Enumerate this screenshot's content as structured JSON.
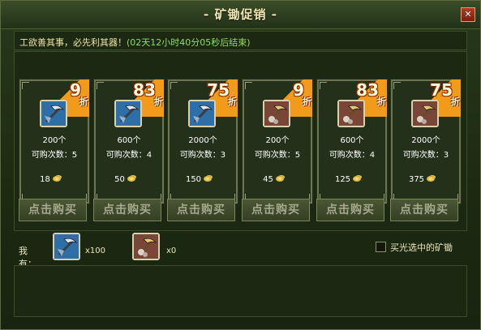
{
  "window": {
    "title": "- 矿锄促销 -",
    "close_label": "✕"
  },
  "promo": {
    "text": "工欲善其事，必先利其器！",
    "timer": "(02天12小时40分05秒后结束)"
  },
  "cards": [
    {
      "discount": "9",
      "discount_suffix": "折",
      "quantity": "200个",
      "limit": "可购次数：5",
      "price": "18",
      "buy_label": "点击购买",
      "icon": "steel-pickaxe-icon"
    },
    {
      "discount": "83",
      "discount_suffix": "折",
      "quantity": "600个",
      "limit": "可购次数：4",
      "price": "50",
      "buy_label": "点击购买",
      "icon": "steel-pickaxe-icon"
    },
    {
      "discount": "75",
      "discount_suffix": "折",
      "quantity": "2000个",
      "limit": "可购次数：3",
      "price": "150",
      "buy_label": "点击购买",
      "icon": "steel-pickaxe-icon"
    },
    {
      "discount": "9",
      "discount_suffix": "折",
      "quantity": "200个",
      "limit": "可购次数：5",
      "price": "45",
      "buy_label": "点击购买",
      "icon": "gold-pickaxe-icon"
    },
    {
      "discount": "83",
      "discount_suffix": "折",
      "quantity": "600个",
      "limit": "可购次数：4",
      "price": "125",
      "buy_label": "点击购买",
      "icon": "gold-pickaxe-icon"
    },
    {
      "discount": "75",
      "discount_suffix": "折",
      "quantity": "2000个",
      "limit": "可购次数：3",
      "price": "375",
      "buy_label": "点击购买",
      "icon": "gold-pickaxe-icon"
    }
  ],
  "owned": {
    "label": "我有：",
    "items": [
      {
        "icon": "steel-pickaxe-icon",
        "count": "x100"
      },
      {
        "icon": "gold-pickaxe-icon",
        "count": "x0"
      }
    ]
  },
  "buy_selected": {
    "label": "买光选中的矿锄",
    "checked": false
  },
  "colors": {
    "ribbon": "#f29a1a",
    "timer": "#8fe05a",
    "coin": "#e8c040"
  }
}
